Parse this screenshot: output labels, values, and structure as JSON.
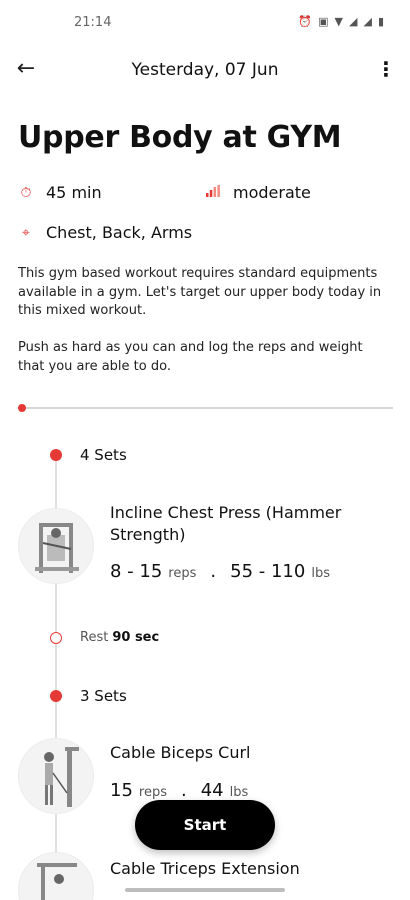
{
  "status": {
    "time": "21:14",
    "icons": [
      "alarm-icon",
      "gallery-icon",
      "wifi-icon",
      "signal-icon",
      "signal-icon",
      "battery-icon"
    ]
  },
  "header": {
    "title": "Yesterday, 07 Jun",
    "back_icon": "arrow-left-icon",
    "menu_icon": "more-vertical-icon"
  },
  "workout": {
    "title": "Upper Body at GYM",
    "duration": "45 min",
    "intensity": "moderate",
    "muscles": "Chest, Back, Arms",
    "description_1": "This gym based workout requires standard equipments available in a gym. Let's target our upper body today in this mixed workout.",
    "description_2": "Push as hard as you can and log the reps and weight that you are able to do.",
    "progress": 0.0
  },
  "exercises": [
    {
      "sets": "4 Sets",
      "name": "Incline Chest Press (Hammer Strength)",
      "reps": "8 - 15",
      "reps_unit": "reps",
      "weight": "55 - 110",
      "weight_unit": "lbs",
      "rest_label": "Rest",
      "rest_value": "90 sec"
    },
    {
      "sets": "3 Sets",
      "name": "Cable Biceps Curl",
      "reps": "15",
      "reps_unit": "reps",
      "weight": "44",
      "weight_unit": "lbs"
    },
    {
      "name": "Cable Triceps Extension"
    }
  ],
  "actions": {
    "start": "Start"
  },
  "colors": {
    "accent": "#e53935",
    "button": "#000000"
  }
}
